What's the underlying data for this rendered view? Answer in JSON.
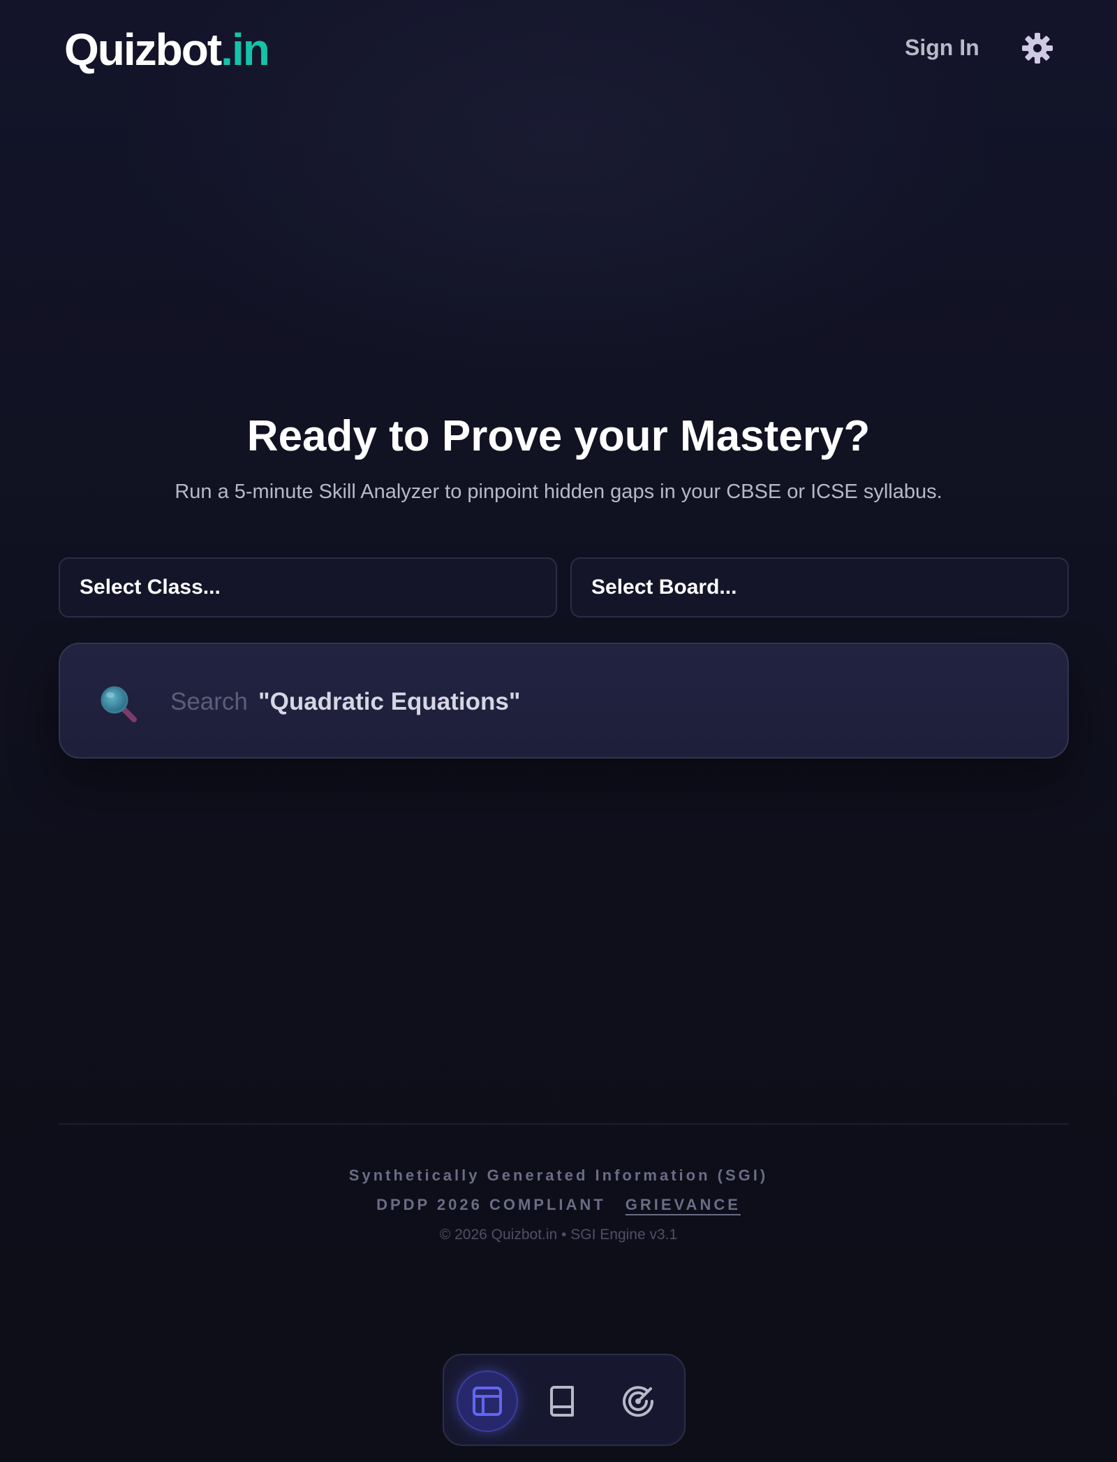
{
  "header": {
    "logo_main": "Quizbot",
    "logo_accent": ".in",
    "signin_label": "Sign In",
    "settings_icon": "gear-icon"
  },
  "hero": {
    "title": "Ready to Prove your Mastery?",
    "subtitle": "Run a 5-minute Skill Analyzer to pinpoint hidden gaps in your CBSE or ICSE syllabus."
  },
  "filters": {
    "class_select": "Select Class...",
    "board_select": "Select Board..."
  },
  "search": {
    "icon": "magnifier-icon",
    "label": "Search",
    "example": "\"Quadratic Equations\""
  },
  "footer": {
    "sgi": "Synthetically Generated Information (SGI)",
    "compliance": "DPDP 2026 COMPLIANT",
    "grievance": "GRIEVANCE",
    "copyright": "© 2026 Quizbot.in • SGI Engine v3.1"
  },
  "bottom_nav": {
    "items": [
      {
        "icon": "layout-icon",
        "active": true
      },
      {
        "icon": "book-icon",
        "active": false
      },
      {
        "icon": "radar-icon",
        "active": false
      }
    ]
  },
  "colors": {
    "background": "#0f0f1a",
    "accent": "#14c3a8",
    "nav_active": "#6366f1"
  }
}
